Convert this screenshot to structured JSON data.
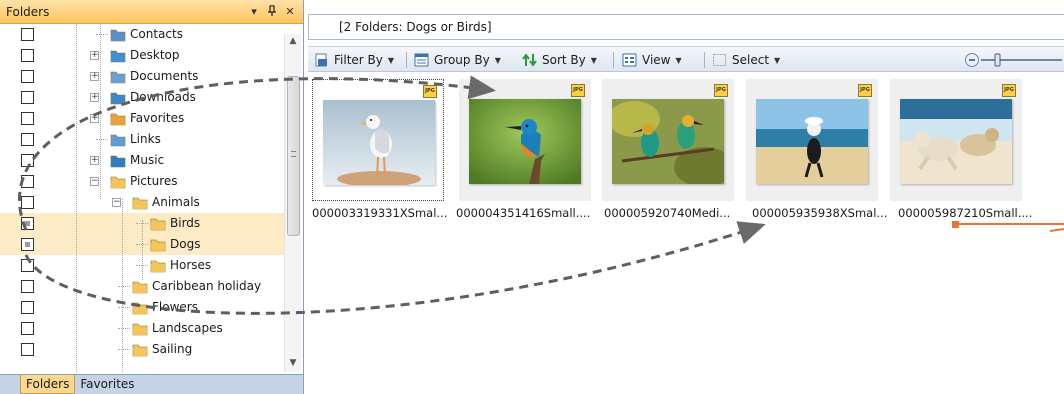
{
  "folders_panel": {
    "title": "Folders",
    "pin_glyph": "▾",
    "autohide_glyph": "ᵖ",
    "close_glyph": "✕",
    "tree": [
      {
        "label": "Contacts",
        "icon": "contacts-folder-icon",
        "checked": false,
        "selected": false,
        "level": 0,
        "expander": ""
      },
      {
        "label": "Desktop",
        "icon": "desktop-folder-icon",
        "checked": false,
        "selected": false,
        "level": 0,
        "expander": "+"
      },
      {
        "label": "Documents",
        "icon": "documents-folder-icon",
        "checked": false,
        "selected": false,
        "level": 0,
        "expander": "+"
      },
      {
        "label": "Downloads",
        "icon": "downloads-folder-icon",
        "checked": false,
        "selected": false,
        "level": 0,
        "expander": "+"
      },
      {
        "label": "Favorites",
        "icon": "favorites-folder-icon",
        "checked": false,
        "selected": false,
        "level": 0,
        "expander": "+"
      },
      {
        "label": "Links",
        "icon": "links-folder-icon",
        "checked": false,
        "selected": false,
        "level": 0,
        "expander": ""
      },
      {
        "label": "Music",
        "icon": "music-folder-icon",
        "checked": false,
        "selected": false,
        "level": 0,
        "expander": "+"
      },
      {
        "label": "Pictures",
        "icon": "folder-icon",
        "checked": false,
        "selected": false,
        "level": 0,
        "expander": "−"
      },
      {
        "label": "Animals",
        "icon": "folder-icon",
        "checked": false,
        "selected": false,
        "level": 1,
        "expander": "−"
      },
      {
        "label": "Birds",
        "icon": "folder-icon",
        "checked": true,
        "selected": true,
        "level": 2,
        "expander": ""
      },
      {
        "label": "Dogs",
        "icon": "folder-icon",
        "checked": true,
        "selected": true,
        "level": 2,
        "expander": ""
      },
      {
        "label": "Horses",
        "icon": "folder-icon",
        "checked": false,
        "selected": false,
        "level": 2,
        "expander": ""
      },
      {
        "label": "Caribbean holiday",
        "icon": "folder-icon",
        "checked": false,
        "selected": false,
        "level": 1,
        "expander": ""
      },
      {
        "label": "Flowers",
        "icon": "folder-icon",
        "checked": false,
        "selected": false,
        "level": 1,
        "expander": ""
      },
      {
        "label": "Landscapes",
        "icon": "folder-icon",
        "checked": false,
        "selected": false,
        "level": 1,
        "expander": ""
      },
      {
        "label": "Sailing",
        "icon": "folder-icon",
        "checked": false,
        "selected": false,
        "level": 1,
        "expander": ""
      }
    ],
    "tabs": [
      {
        "label": "Folders",
        "active": true
      },
      {
        "label": "Favorites",
        "active": false
      }
    ]
  },
  "address_bar": {
    "text": "[2 Folders: Dogs or Birds]"
  },
  "toolbar": {
    "filter_label": "Filter By",
    "group_label": "Group By",
    "sort_label": "Sort By",
    "view_label": "View",
    "select_label": "Select",
    "dropdown_glyph": "▼",
    "zoom_out_glyph": "−"
  },
  "thumbnails": [
    {
      "caption": "000003319331XSmal...",
      "badge": "JPG",
      "subject": "seagull-photo",
      "focused": true
    },
    {
      "caption": "000004351416Small....",
      "badge": "JPG",
      "subject": "kingfisher-photo",
      "focused": false
    },
    {
      "caption": "000005920740Medi...",
      "badge": "JPG",
      "subject": "bee-eaters-photo",
      "focused": false
    },
    {
      "caption": "000005935938XSmal...",
      "badge": "JPG",
      "subject": "dog-on-beach-photo",
      "focused": false
    },
    {
      "caption": "000005987210Small....",
      "badge": "JPG",
      "subject": "dogs-running-photo",
      "focused": false
    }
  ],
  "colors": {
    "panel_header": "#fcc45e",
    "selection": "#fcebc4",
    "callout": "#e8743b",
    "arrow": "#666666"
  }
}
